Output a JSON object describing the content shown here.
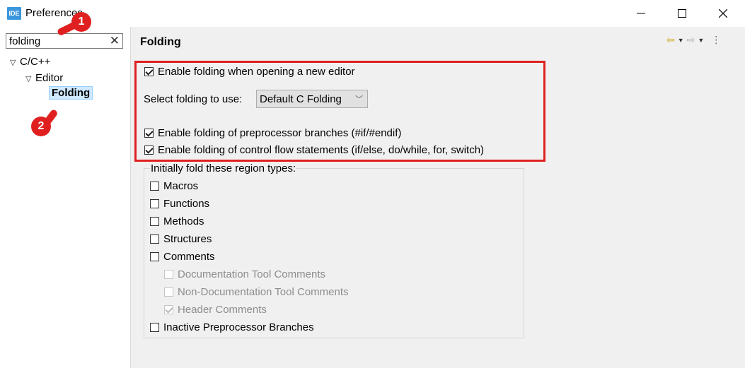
{
  "window": {
    "app_icon": "IDE",
    "title": "Preferences",
    "minimize_icon": "minimize-icon",
    "maximize_icon": "maximize-icon",
    "close_icon": "close-icon"
  },
  "sidebar": {
    "search_value": "folding",
    "clear_icon": "✕",
    "tree": [
      {
        "label": "C/C++",
        "expanded": true
      },
      {
        "label": "Editor",
        "expanded": true
      },
      {
        "label": "Folding",
        "selected": true
      }
    ]
  },
  "page": {
    "title": "Folding",
    "enable_on_open": {
      "label": "Enable folding when opening a new editor",
      "checked": true
    },
    "select_label": "Select folding to use:",
    "select_value": "Default C Folding",
    "preprocessor": {
      "label": "Enable folding of preprocessor branches (#if/#endif)",
      "checked": true
    },
    "control_flow": {
      "label": "Enable folding of control flow statements (if/else, do/while, for, switch)",
      "checked": true
    },
    "group_label": "Initially fold these region types:",
    "regions": [
      {
        "label": "Macros",
        "checked": false,
        "disabled": false
      },
      {
        "label": "Functions",
        "checked": false,
        "disabled": false
      },
      {
        "label": "Methods",
        "checked": false,
        "disabled": false
      },
      {
        "label": "Structures",
        "checked": false,
        "disabled": false
      },
      {
        "label": "Comments",
        "checked": false,
        "disabled": false
      },
      {
        "label": "Documentation Tool Comments",
        "checked": false,
        "disabled": true
      },
      {
        "label": "Non-Documentation Tool Comments",
        "checked": false,
        "disabled": true
      },
      {
        "label": "Header Comments",
        "checked": true,
        "disabled": true
      },
      {
        "label": "Inactive Preprocessor Branches",
        "checked": false,
        "disabled": false
      }
    ]
  },
  "annotations": {
    "marker_1": "1",
    "marker_2": "2",
    "highlight_color": "#e02020"
  },
  "colors": {
    "selection_bg": "#cde8ff",
    "panel_bg": "#f0f0f0",
    "back_arrow": "#c8a400"
  }
}
